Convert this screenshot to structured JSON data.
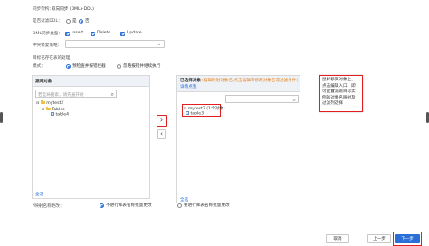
{
  "form": {
    "sync_arch_label": "同步架构：",
    "sync_arch_value": "双向同步 (DML+DDL)",
    "ddl_filter_label": "是否过滤DDL：",
    "ddl_filter_options": [
      "是",
      "否"
    ],
    "dml_label": "DML同步类型：",
    "dml_options": [
      "Insert",
      "Delete",
      "Update"
    ],
    "conflict_label": "冲突修复策略：",
    "conflict_value": "",
    "target_exists_label": "目标已存在表的处理",
    "mode_label": "模式：",
    "mode_options": [
      "预检查并报错拦截",
      "忽略报错并继续执行"
    ]
  },
  "source_panel": {
    "title": "源库对象",
    "search_placeholder": "若全局搜索，请先展开树",
    "tree": {
      "db": "mytest2",
      "group": "Tables",
      "table": "table4"
    },
    "select_all": "全选"
  },
  "transfer": {
    "right_arrow": "›",
    "left_arrow": "‹"
  },
  "target_panel": {
    "title": "已选择对象",
    "hint": "(编辑映射对象名,点击编辑可修改对象名或过滤条件)",
    "detail_link": "详情点我",
    "tree": {
      "db": "mytest2 (1个对象)",
      "table": "table3"
    },
    "select_all": "全选"
  },
  "tooltip": {
    "text_lines": [
      "鼠标移到对象上，",
      "点击编辑入口，即",
      "可配置源跟目标实",
      "例的对象名映射及",
      "过滤列选择"
    ]
  },
  "rename": {
    "label": "*映射名称更改：",
    "options": [
      "不进行库表名称批量更改",
      "要进行库表名称批量更改"
    ]
  },
  "footer": {
    "cancel": "取消",
    "prev": "上一步",
    "next": "下一步"
  },
  "colors": {
    "accent": "#2a6fd6",
    "highlight": "#e02020",
    "hint": "#e8801a",
    "primary_button": "#2a6fd6"
  }
}
